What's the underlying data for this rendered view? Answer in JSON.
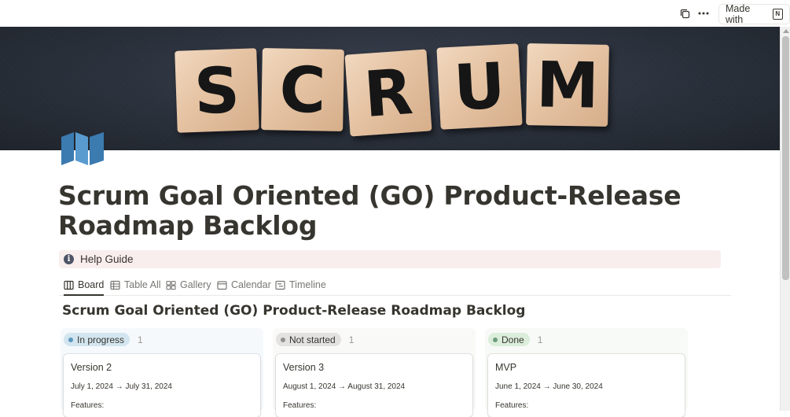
{
  "topbar": {
    "duplicate_icon": "duplicate-icon",
    "more_icon": "more-icon",
    "made_with_label": "Made with",
    "notion_logo_letter": "N"
  },
  "cover": {
    "letters": [
      "S",
      "C",
      "R",
      "U",
      "M"
    ]
  },
  "page": {
    "title": "Scrum Goal Oriented (GO) Product-Release Roadmap Backlog",
    "icon": "map-icon"
  },
  "callout": {
    "icon": "info-icon",
    "text": "Help Guide"
  },
  "tabs": [
    {
      "label": "Board",
      "icon": "board-icon",
      "active": true
    },
    {
      "label": "Table All",
      "icon": "table-icon",
      "active": false
    },
    {
      "label": "Gallery",
      "icon": "gallery-icon",
      "active": false
    },
    {
      "label": "Calendar",
      "icon": "calendar-icon",
      "active": false
    },
    {
      "label": "Timeline",
      "icon": "timeline-icon",
      "active": false
    }
  ],
  "board": {
    "title": "Scrum Goal Oriented (GO) Product-Release Roadmap Backlog",
    "columns": [
      {
        "status": "In progress",
        "count": "1",
        "colors": {
          "column_bg": "#f5f9fc",
          "pill_bg": "#d3e5ef",
          "dot": "#5b97bd"
        },
        "card": {
          "title": "Version 2",
          "date": "July 1, 2024 → July 31, 2024",
          "features_label": "Features:"
        }
      },
      {
        "status": "Not started",
        "count": "1",
        "colors": {
          "column_bg": "#f9f9f8",
          "pill_bg": "#e3e2e0",
          "dot": "#91918e"
        },
        "card": {
          "title": "Version 3",
          "date": "August 1, 2024 → August 31, 2024",
          "features_label": "Features:"
        }
      },
      {
        "status": "Done",
        "count": "1",
        "colors": {
          "column_bg": "#f8faf7",
          "pill_bg": "#dbeddb",
          "dot": "#6c9b7d"
        },
        "card": {
          "title": "MVP",
          "date": "June 1, 2024 → June 30, 2024",
          "features_label": "Features:"
        }
      }
    ]
  }
}
